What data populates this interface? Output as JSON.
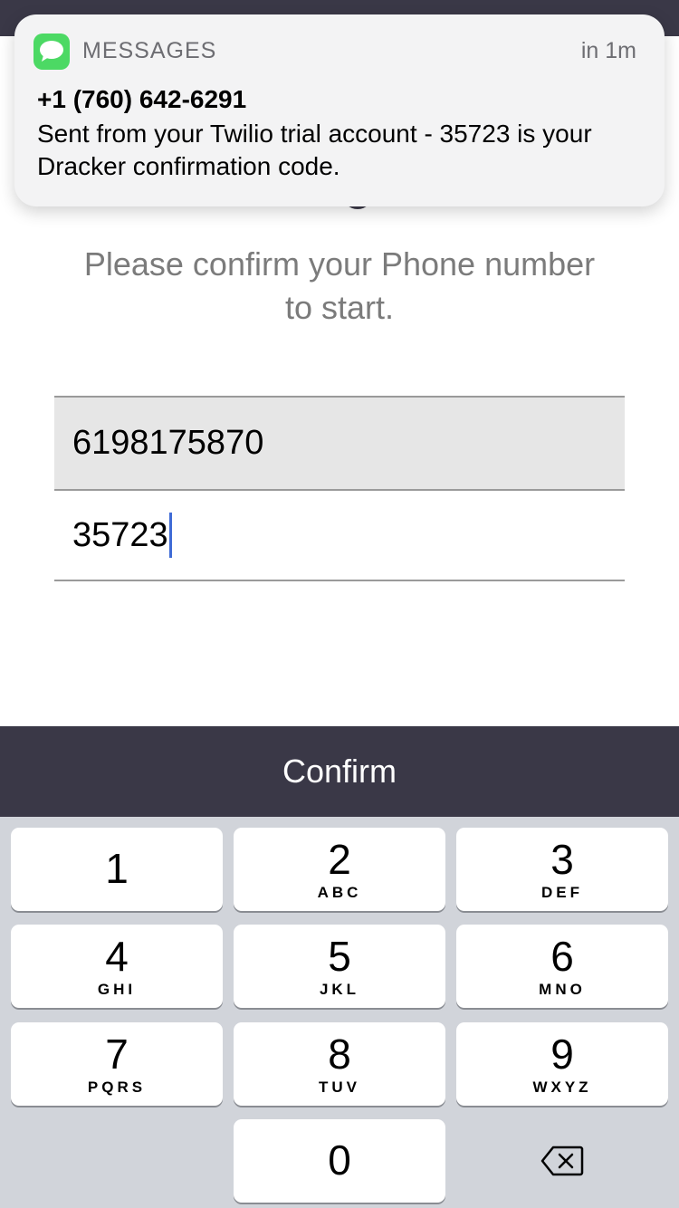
{
  "notification": {
    "app_name": "MESSAGES",
    "time": "in 1m",
    "sender": "+1 (760) 642-6291",
    "body": "Sent from your Twilio trial account - 35723 is your Dracker confirmation code.",
    "icon": "messages-app-icon"
  },
  "prompt": {
    "line1": "Please confirm your Phone number",
    "line2": "to start."
  },
  "form": {
    "phone_value": "6198175870",
    "code_value": "35723"
  },
  "confirm_label": "Confirm",
  "keypad": {
    "keys": [
      {
        "digit": "1",
        "letters": ""
      },
      {
        "digit": "2",
        "letters": "ABC"
      },
      {
        "digit": "3",
        "letters": "DEF"
      },
      {
        "digit": "4",
        "letters": "GHI"
      },
      {
        "digit": "5",
        "letters": "JKL"
      },
      {
        "digit": "6",
        "letters": "MNO"
      },
      {
        "digit": "7",
        "letters": "PQRS"
      },
      {
        "digit": "8",
        "letters": "TUV"
      },
      {
        "digit": "9",
        "letters": "WXYZ"
      },
      {
        "digit": "0",
        "letters": ""
      }
    ],
    "delete_icon": "backspace-icon"
  },
  "colors": {
    "header": "#3a3847",
    "caret": "#3f6bd6",
    "messages_green": "#4cd964",
    "keypad_bg": "#d1d4da"
  }
}
